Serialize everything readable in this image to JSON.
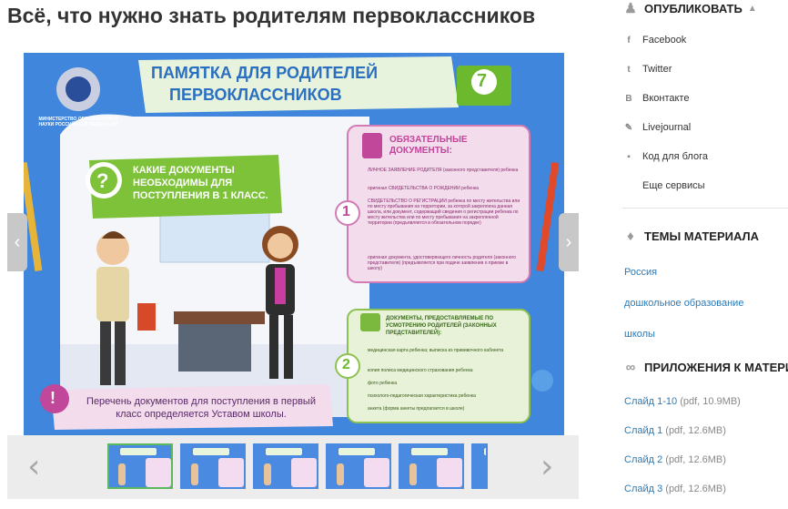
{
  "page": {
    "title": "Всё, что нужно знать родителям первоклассников"
  },
  "slide": {
    "ministry": "МИНИСТЕРСТВО ОБРАЗОВАНИЯ И НАУКИ РОССИЙСКОЙ ФЕДЕРАЦИИ",
    "banner_line1": "ПАМЯТКА ДЛЯ РОДИТЕЛЕЙ",
    "banner_line2": "ПЕРВОКЛАССНИКОВ",
    "badge_number": "7",
    "question_mark": "?",
    "question_text": "КАКИЕ ДОКУМЕНТЫ НЕОБХОДИМЫ ДЛЯ ПОСТУПЛЕНИЯ В 1 КЛАСС.",
    "card1": {
      "number": "1",
      "title": "ОБЯЗАТЕЛЬНЫЕ ДОКУМЕНТЫ:",
      "items": [
        "ЛИЧНОЕ ЗАЯВЛЕНИЕ РОДИТЕЛЯ (законного представителя) ребенка",
        "оригинал СВИДЕТЕЛЬСТВА О РОЖДЕНИИ ребенка",
        "СВИДЕТЕЛЬСТВО О РЕГИСТРАЦИИ ребенка по месту жительства или по месту пребывания на территории, за которой закреплена данная школа, или документ, содержащий сведения о регистрации ребенка по месту жительства или по месту пребывания на закрепленной территории (предъявляется в обязательном порядке)",
        "оригинал документа, удостоверяющего личность родителя (законного представителя) (предъявляется при подаче заявления о приеме в школу)"
      ]
    },
    "card2": {
      "number": "2",
      "title": "ДОКУМЕНТЫ, ПРЕДОСТАВЛЯЕМЫЕ ПО УСМОТРЕНИЮ РОДИТЕЛЕЙ (ЗАКОННЫХ ПРЕДСТАВИТЕЛЕЙ):",
      "items": [
        "медицинская карта ребенка; выписка из прививочного кабинета",
        "копия полиса медицинского страхования ребенка",
        "фото ребенка",
        "психолого-педагогическая характеристика ребенка",
        "анкета (форма анкеты предлагается в школе)"
      ]
    },
    "note_mark": "!",
    "note_text": "Перечень документов для поступления в первый класс определяется Уставом школы."
  },
  "viewer": {
    "prev_slide": "‹",
    "next_slide": "›",
    "thumb_prev": "‹",
    "thumb_next": "›"
  },
  "sidebar": {
    "publish_heading": "ОПУБЛИКОВАТЬ",
    "share": [
      {
        "label": "Facebook",
        "icon": "f"
      },
      {
        "label": "Twitter",
        "icon": "t"
      },
      {
        "label": "Вконтакте",
        "icon": "B"
      },
      {
        "label": "Livejournal",
        "icon": "✎"
      },
      {
        "label": "Код для блога",
        "icon": "▪"
      },
      {
        "label": "Еще сервисы",
        "icon": ""
      }
    ],
    "topics_heading": "ТЕМЫ МАТЕРИАЛА",
    "topics": [
      "Россия",
      "дошкольное образование",
      "школы"
    ],
    "attach_heading": "ПРИЛОЖЕНИЯ К МАТЕРИАЛУ",
    "attachments": [
      {
        "name": "Слайд 1-10",
        "meta": "(pdf, 10.9MB)"
      },
      {
        "name": "Слайд 1",
        "meta": "(pdf, 12.6MB)"
      },
      {
        "name": "Слайд 2",
        "meta": "(pdf, 12.6MB)"
      },
      {
        "name": "Слайд 3",
        "meta": "(pdf, 12.6MB)"
      }
    ]
  }
}
